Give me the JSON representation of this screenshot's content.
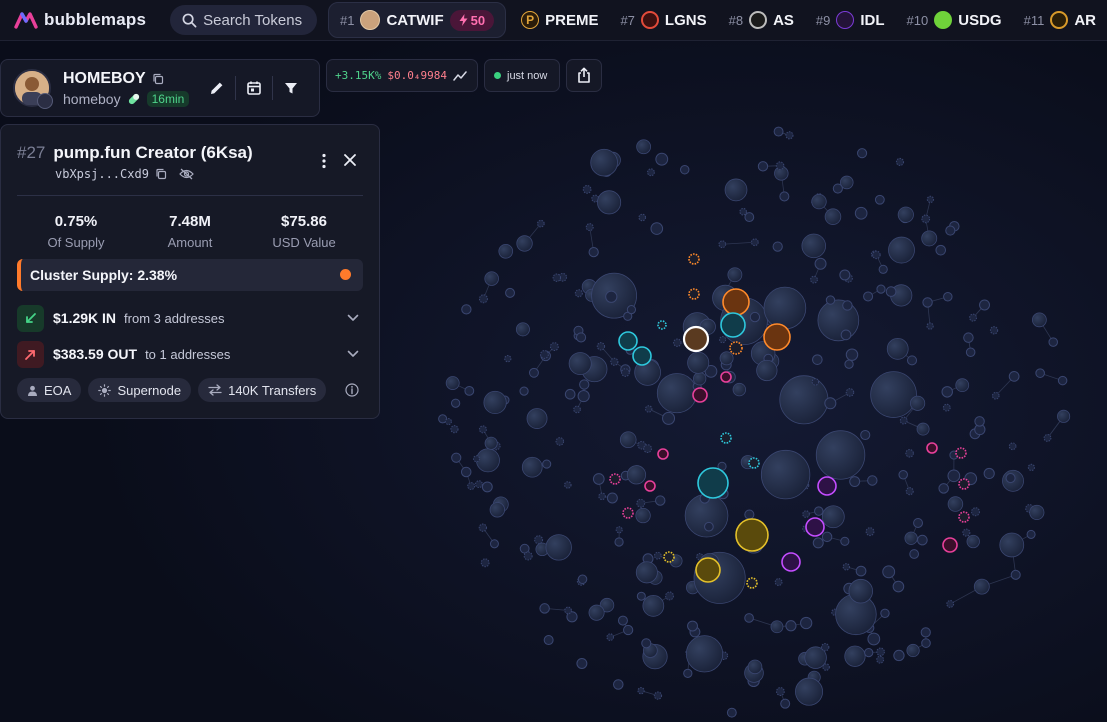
{
  "app": {
    "name": "bubblemaps",
    "brand_color": "#e8409a"
  },
  "search": {
    "placeholder": "Search Tokens"
  },
  "ticker": [
    {
      "rank": "#1",
      "name": "CATWIF",
      "boost": "50",
      "active": true,
      "icon_color": "#caa27c"
    },
    {
      "rank": "",
      "name": "PREME",
      "icon_color": "#e0a43a",
      "icon_letter": "P"
    },
    {
      "rank": "#7",
      "name": "LGNS",
      "icon_color": "#e24b3a"
    },
    {
      "rank": "#8",
      "name": "AS",
      "icon_color": "#2a2a2a"
    },
    {
      "rank": "#9",
      "name": "IDL",
      "icon_color": "#7b3bd6"
    },
    {
      "rank": "#10",
      "name": "USDG",
      "icon_color": "#6fd23a"
    },
    {
      "rank": "#11",
      "name": "AR",
      "icon_color": "#d89a2a"
    }
  ],
  "token": {
    "name": "HOMEBOY",
    "symbol": "homeboy",
    "age": "16min"
  },
  "price": {
    "change": "+3.15K%",
    "value": "$0.0₄9984"
  },
  "updated": {
    "label": "just now"
  },
  "wallet": {
    "rank": "#27",
    "name": "pump.fun Creator (6Ksa)",
    "address": "vbXpsj...Cxd9",
    "stats": [
      {
        "value": "0.75%",
        "label": "Of Supply"
      },
      {
        "value": "7.48M",
        "label": "Amount"
      },
      {
        "value": "$75.86",
        "label": "USD Value"
      }
    ],
    "cluster_supply": "Cluster Supply: 2.38%",
    "cluster_color": "#ff7a2b",
    "inflow": {
      "amount": "$1.29K IN",
      "detail": "from 3 addresses"
    },
    "outflow": {
      "amount": "$383.59 OUT",
      "detail": "to 1 addresses"
    },
    "tags": [
      "EOA",
      "Supernode",
      "140K Transfers"
    ]
  }
}
